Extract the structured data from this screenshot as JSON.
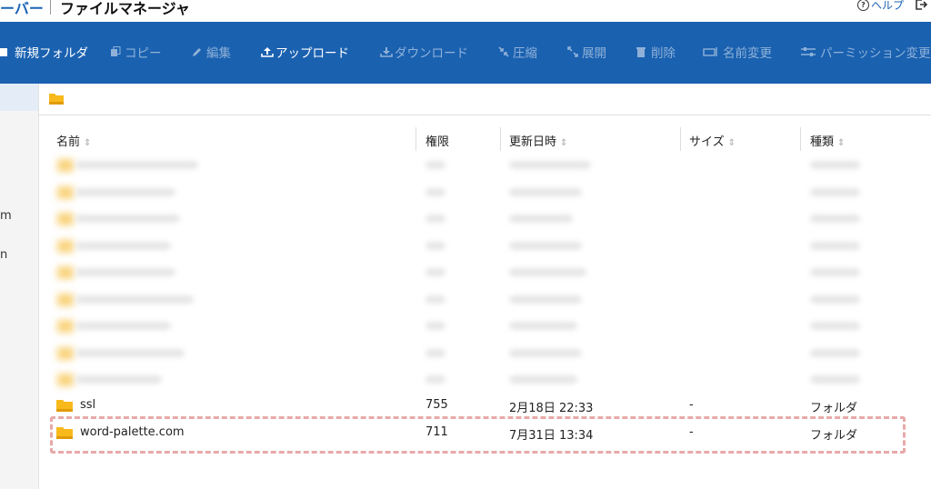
{
  "header": {
    "brand": "ーバー",
    "app_title": "ファイルマネージャ",
    "help_label": "ヘルプ"
  },
  "toolbar": {
    "new_folder": "新規フォルダ",
    "copy": "コピー",
    "edit": "編集",
    "upload": "アップロード",
    "download": "ダウンロード",
    "compress": "圧縮",
    "extract": "展開",
    "delete": "削除",
    "rename": "名前変更",
    "permission": "パーミッション変更"
  },
  "sidebar": {
    "fragments": [
      "m",
      "n"
    ]
  },
  "table": {
    "headers": {
      "name": "名前",
      "permission": "権限",
      "modified": "更新日時",
      "size": "サイズ",
      "type": "種類"
    },
    "rows": [
      {
        "name": "ssl",
        "permission": "755",
        "modified": "2月18日 22:33",
        "size": "-",
        "type": "フォルダ"
      },
      {
        "name": "word-palette.com",
        "permission": "711",
        "modified": "7月31日 13:34",
        "size": "-",
        "type": "フォルダ"
      }
    ]
  },
  "colors": {
    "toolbar_bg": "#1a61b0",
    "brand": "#1d63b5",
    "folder": "#f8b91c",
    "highlight": "#e8a9a9"
  }
}
